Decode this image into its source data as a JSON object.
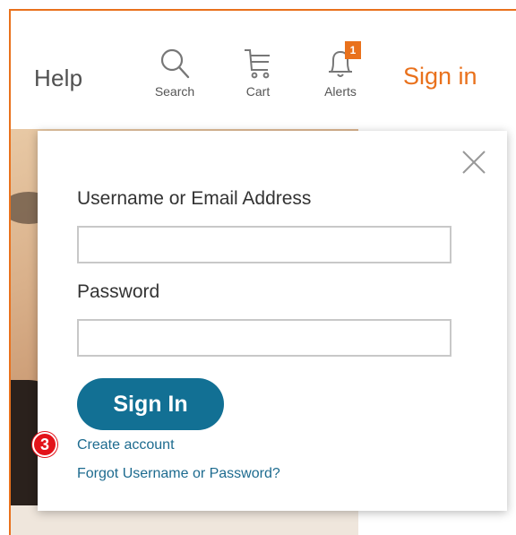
{
  "header": {
    "help_label": "Help",
    "search_label": "Search",
    "cart_label": "Cart",
    "alerts_label": "Alerts",
    "alerts_count": "1",
    "signin_label": "Sign in"
  },
  "login_panel": {
    "username_label": "Username or Email Address",
    "username_value": "",
    "password_label": "Password",
    "password_value": "",
    "signin_button": "Sign In",
    "create_account_link": "Create account",
    "forgot_link": "Forgot Username or Password?"
  },
  "annotation": {
    "step_number": "3"
  },
  "colors": {
    "accent_orange": "#e9711c",
    "button_blue": "#127094",
    "link_blue": "#1d6b8f",
    "badge_red": "#e3131a"
  },
  "icons": [
    "search-icon",
    "cart-icon",
    "bell-icon",
    "close-icon"
  ]
}
